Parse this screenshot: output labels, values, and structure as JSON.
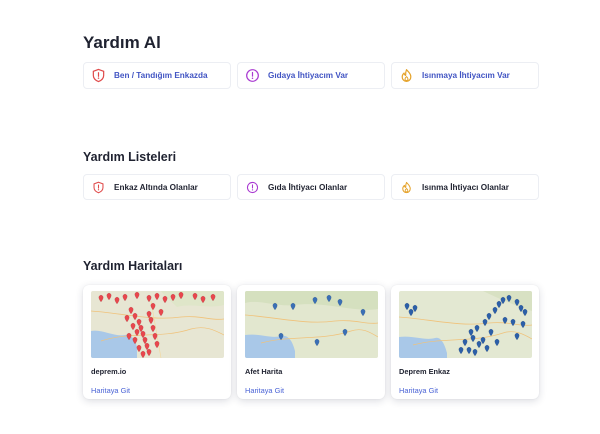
{
  "help": {
    "title": "Yardım Al",
    "buttons": [
      {
        "label": "Ben / Tandığım Enkazda",
        "icon": "shield-alert-icon",
        "color": "#e04b4b"
      },
      {
        "label": "Gıdaya İhtiyacım Var",
        "icon": "alert-circle-icon",
        "color": "#a93ad1"
      },
      {
        "label": "Isınmaya İhtiyacım Var",
        "icon": "flame-icon",
        "color": "#e5a32b"
      }
    ]
  },
  "lists": {
    "title": "Yardım Listeleri",
    "buttons": [
      {
        "label": "Enkaz Altında Olanlar",
        "icon": "shield-alert-icon",
        "color": "#e04b4b"
      },
      {
        "label": "Gıda İhtiyacı Olanlar",
        "icon": "alert-circle-icon",
        "color": "#a93ad1"
      },
      {
        "label": "Isınma İhtiyacı Olanlar",
        "icon": "flame-icon",
        "color": "#e5a32b"
      }
    ]
  },
  "maps": {
    "title": "Yardım Haritaları",
    "cards": [
      {
        "title": "deprem.io",
        "link": "Haritaya Git",
        "marker_color": "#e8464d"
      },
      {
        "title": "Afet Harita",
        "link": "Haritaya Git",
        "marker_color": "#3a6fb5"
      },
      {
        "title": "Deprem Enkaz",
        "link": "Haritaya Git",
        "marker_color": "#2c5fa8"
      }
    ]
  },
  "colors": {
    "accent": "#4154c3",
    "link": "#4a63d6",
    "sea": "#a9c8e8",
    "land": "#e6e8d2"
  }
}
